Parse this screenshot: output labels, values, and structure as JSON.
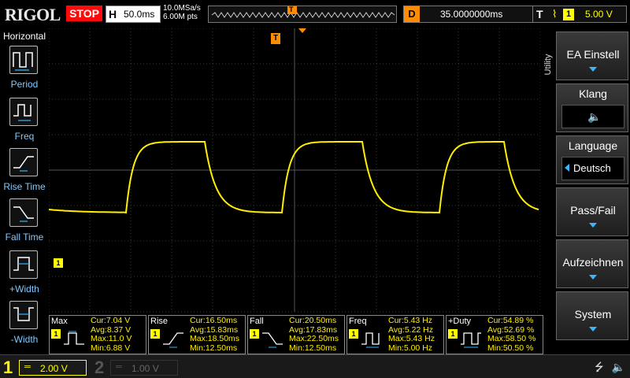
{
  "topbar": {
    "logo": "RIGOL",
    "run_state": "STOP",
    "timebase_key": "H",
    "timebase_value": "50.0ms",
    "sample_rate": "10.0MSa/s",
    "memory_depth": "6.00M pts",
    "trigger_marker": "T",
    "delay_key": "D",
    "delay_value": "35.0000000ms",
    "trigger_key": "T",
    "trigger_source": "1",
    "trigger_level": "5.00 V",
    "colors": {
      "stop": "#ff0a0a",
      "delay": "#ff8c00",
      "channel1": "#ffff00"
    }
  },
  "left_panel": {
    "title": "Horizontal",
    "items": [
      {
        "label": "Period",
        "icon": "period-icon"
      },
      {
        "label": "Freq",
        "icon": "frequency-icon"
      },
      {
        "label": "Rise Time",
        "icon": "rise-time-icon"
      },
      {
        "label": "Fall Time",
        "icon": "fall-time-icon"
      },
      {
        "label": "+Width",
        "icon": "positive-width-icon"
      },
      {
        "label": "-Width",
        "icon": "negative-width-icon"
      }
    ]
  },
  "right_panel": {
    "tab": "Utility",
    "buttons": [
      {
        "label": "EA Einstell",
        "has_arrow": true
      },
      {
        "label": "Klang",
        "value_icon": "speaker-muted-icon"
      },
      {
        "label": "Language",
        "value": "Deutsch"
      },
      {
        "label": "Pass/Fail",
        "has_arrow": true
      },
      {
        "label": "Aufzeichnen",
        "has_arrow": true
      },
      {
        "label": "System",
        "has_arrow": true
      }
    ]
  },
  "markers": {
    "trigger_position": "T",
    "channel1_offset": "1"
  },
  "measurements": [
    {
      "name": "Max",
      "channel": "1",
      "cur": "Cur:7.04 V",
      "avg": "Avg:8.37 V",
      "max": "Max:11.0 V",
      "min": "Min:6.88 V"
    },
    {
      "name": "Rise",
      "channel": "1",
      "cur": "Cur:16.50ms",
      "avg": "Avg:15.83ms",
      "max": "Max:18.50ms",
      "min": "Min:12.50ms"
    },
    {
      "name": "Fall",
      "channel": "1",
      "cur": "Cur:20.50ms",
      "avg": "Avg:17.83ms",
      "max": "Max:22.50ms",
      "min": "Min:12.50ms"
    },
    {
      "name": "Freq",
      "channel": "1",
      "cur": "Cur:5.43 Hz",
      "avg": "Avg:5.22 Hz",
      "max": "Max:5.43 Hz",
      "min": "Min:5.00 Hz"
    },
    {
      "name": "+Duty",
      "channel": "1",
      "cur": "Cur:54.89 %",
      "avg": "Avg:52.69 %",
      "max": "Max:58.50 %",
      "min": "Min:50.50 %"
    }
  ],
  "bottombar": {
    "ch1_number": "1",
    "ch1_scale": "2.00 V",
    "ch2_number": "2",
    "ch2_scale": "1.00 V",
    "status_icons": "usb-icon speaker-muted-icon"
  }
}
